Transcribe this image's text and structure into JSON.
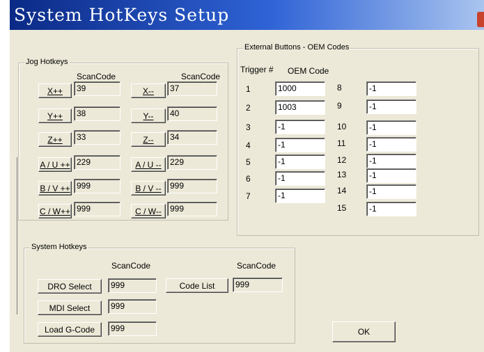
{
  "title": "System HotKeys Setup",
  "jog": {
    "legend": "Jog Hotkeys",
    "scancode_header_left": "ScanCode",
    "scancode_header_right": "ScanCode",
    "rows": [
      {
        "left_label": "X++",
        "left_value": "39",
        "right_label": "X--",
        "right_value": "37"
      },
      {
        "left_label": "Y++",
        "left_value": "38",
        "right_label": "Y--",
        "right_value": "40"
      },
      {
        "left_label": "Z++",
        "left_value": "33",
        "right_label": "Z--",
        "right_value": "34"
      },
      {
        "left_label": "A / U ++",
        "left_value": "229",
        "right_label": "A / U --",
        "right_value": "229"
      },
      {
        "left_label": "B / V ++",
        "left_value": "999",
        "right_label": "B / V --",
        "right_value": "999"
      },
      {
        "left_label": "C / W++",
        "left_value": "999",
        "right_label": "C / W--",
        "right_value": "999"
      }
    ]
  },
  "external": {
    "legend": "External Buttons - OEM Codes",
    "trigger_header": "Trigger #",
    "oem_header": "OEM Code",
    "left": [
      {
        "n": "1",
        "v": "1000"
      },
      {
        "n": "2",
        "v": "1003"
      },
      {
        "n": "3",
        "v": "-1"
      },
      {
        "n": "4",
        "v": "-1"
      },
      {
        "n": "5",
        "v": "-1"
      },
      {
        "n": "6",
        "v": "-1"
      },
      {
        "n": "7",
        "v": "-1"
      }
    ],
    "right": [
      {
        "n": "8",
        "v": "-1"
      },
      {
        "n": "9",
        "v": "-1"
      },
      {
        "n": "10",
        "v": "-1"
      },
      {
        "n": "11",
        "v": "-1"
      },
      {
        "n": "12",
        "v": "-1"
      },
      {
        "n": "13",
        "v": "-1"
      },
      {
        "n": "14",
        "v": "-1"
      },
      {
        "n": "15",
        "v": "-1"
      }
    ]
  },
  "system": {
    "legend": "System Hotkeys",
    "scancode_header_left": "ScanCode",
    "scancode_header_right": "ScanCode",
    "dro_label": "DRO Select",
    "dro_value": "999",
    "mdi_label": "MDI Select",
    "mdi_value": "999",
    "load_label": "Load G-Code",
    "load_value": "999",
    "codelist_label": "Code List",
    "codelist_value": "999"
  },
  "ok_label": "OK"
}
